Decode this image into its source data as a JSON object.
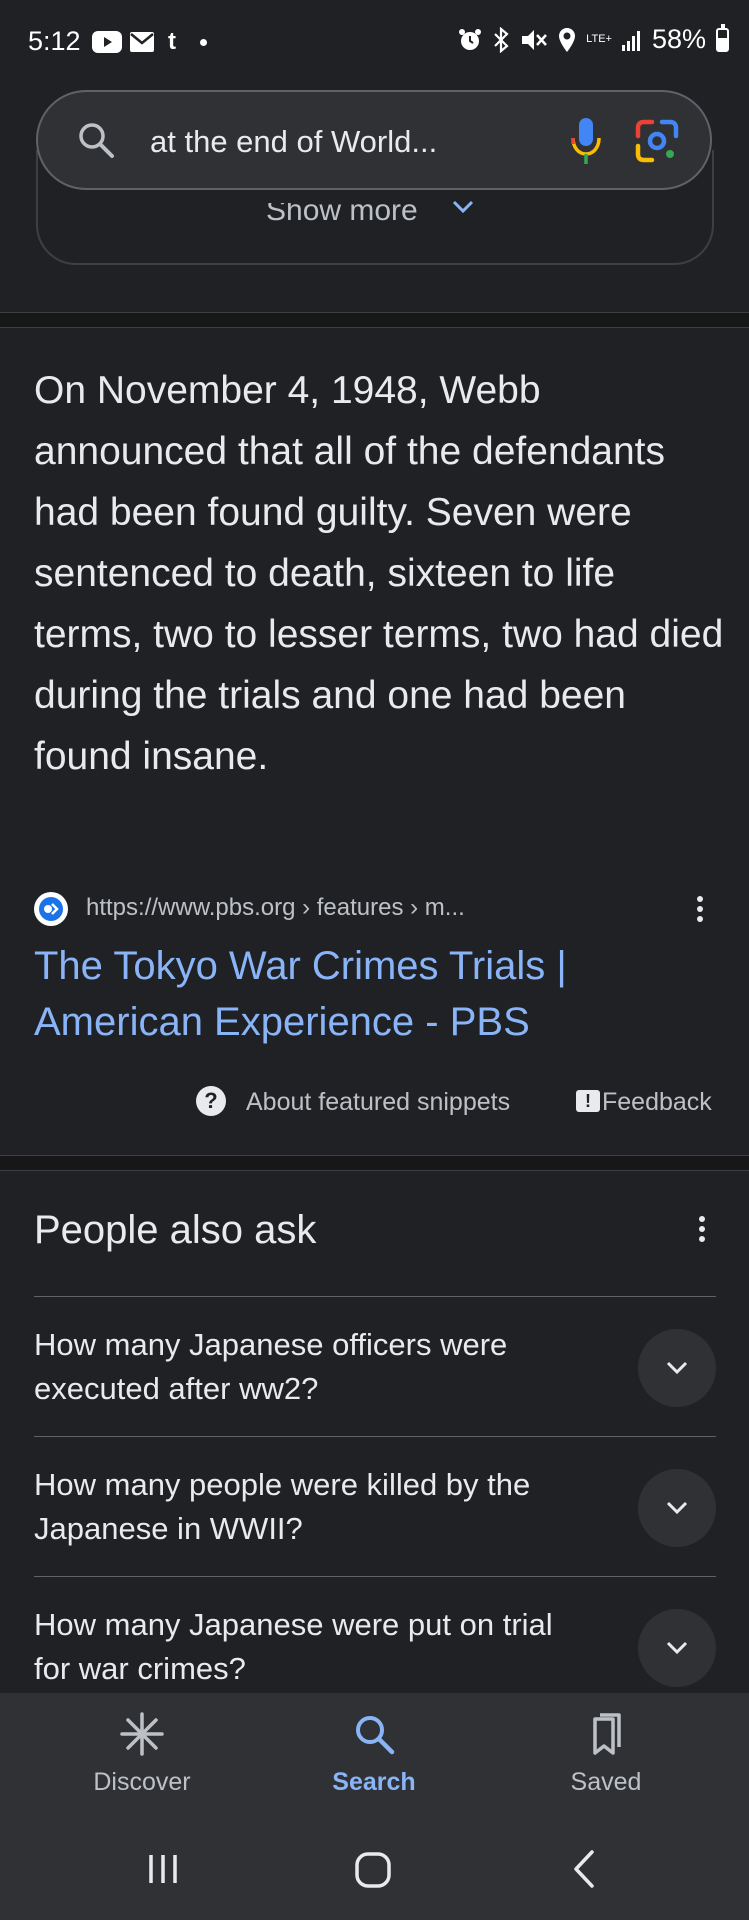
{
  "status_bar": {
    "time": "5:12",
    "network": "LTE+",
    "battery": "58%",
    "battery_level": 0.58
  },
  "search": {
    "query": "at the end of World..."
  },
  "show_more": {
    "label": "Show more"
  },
  "snippet": {
    "text": "On November 4, 1948, Webb announced that all of the defendants had been found guilty. Seven were sentenced to death, sixteen to life terms, two to lesser terms, two had died during the trials and one had been found insane.",
    "source_url": "https://www.pbs.org › features › m...",
    "title": "The Tokyo War Crimes Trials | American Experience - PBS",
    "about_label": "About featured snippets",
    "feedback_label": "Feedback"
  },
  "people_also_ask": {
    "title": "People also ask",
    "questions": [
      "How many Japanese officers were executed after ww2?",
      "How many people were killed by the Japanese in WWII?",
      "How many Japanese were put on trial for war crimes?"
    ]
  },
  "bottom_nav": {
    "items": [
      {
        "label": "Discover",
        "icon": "asterisk-icon",
        "active": false
      },
      {
        "label": "Search",
        "icon": "search-icon",
        "active": true
      },
      {
        "label": "Saved",
        "icon": "bookmarks-icon",
        "active": false
      }
    ]
  },
  "colors": {
    "background": "#202124",
    "accent": "#8ab4f8",
    "text": "#e8eaed",
    "secondary_text": "#bdc1c6",
    "nav_bg": "#303134"
  }
}
